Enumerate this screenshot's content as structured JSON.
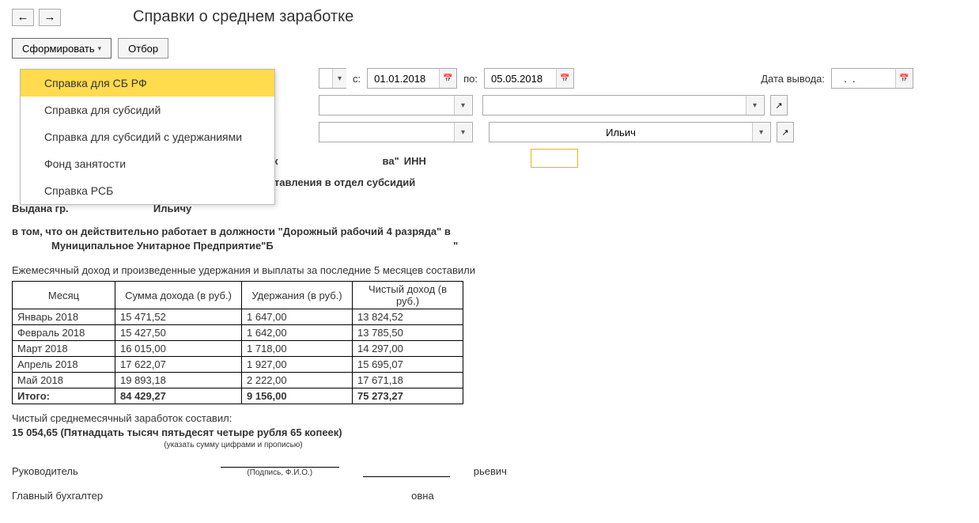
{
  "nav": {
    "back": "←",
    "forward": "→"
  },
  "header": {
    "title": "Справки о среднем заработке"
  },
  "toolbar": {
    "generate_label": "Сформировать",
    "filter_label": "Отбор"
  },
  "menu": {
    "items": [
      "Справка для СБ РФ",
      "Справка для субсидий",
      "Справка для субсидий с удержаниями",
      "Фонд занятости",
      "Справка РСБ"
    ]
  },
  "filters": {
    "from_label": "с:",
    "from_value": "01.01.2018",
    "to_label": "по:",
    "to_value": "05.05.2018",
    "output_date_label": "Дата вывода:",
    "output_date_value": "  .  .    ",
    "person_value": "Ильич"
  },
  "report": {
    "inn_fragment_left": "к",
    "inn_fragment_mid": "ва\"",
    "inn_label": "ИНН",
    "title": "Справка о заработной плате для предоставления в  отдел субсидий",
    "issued_prefix": "Выдана гр.  ",
    "issued_name_suffix": "Ильичу",
    "works_text_1": "в том, что он действительно работает  в должности \"Дорожный рабочий 4 разряда\"   в",
    "works_text_2": "Муниципальное Унитарное Предприятие\"Б",
    "works_text_2_end": "\"",
    "monthly_text": "Ежемесячный доход и произведенные удержания и выплаты за последние 5 месяцев составили",
    "columns": [
      "Месяц",
      "Сумма дохода (в руб.)",
      "Удержания (в руб.)",
      "Чистый доход (в руб.)"
    ],
    "rows": [
      {
        "m": "Январь 2018",
        "a": "15 471,52",
        "b": "1 647,00",
        "c": "13 824,52"
      },
      {
        "m": "Февраль 2018",
        "a": "15 427,50",
        "b": "1 642,00",
        "c": "13 785,50"
      },
      {
        "m": "Март 2018",
        "a": "16 015,00",
        "b": "1 718,00",
        "c": "14 297,00"
      },
      {
        "m": "Апрель 2018",
        "a": "17 622,07",
        "b": "1 927,00",
        "c": "15 695,07"
      },
      {
        "m": "Май 2018",
        "a": "19 893,18",
        "b": "2 222,00",
        "c": "17 671,18"
      }
    ],
    "total_label": "Итого:",
    "total_a": "84 429,27",
    "total_b": "9 156,00",
    "total_c": "75 273,27",
    "avg_label": "Чистый среднемесячный заработок составил:",
    "avg_value": "15 054,65 (Пятнадцать тысяч пятьдесят четыре рубля 65 копеек)",
    "avg_hint": "(указать сумму цифрами и прописью)",
    "manager_label": "Руководитель",
    "manager_end": "рьевич",
    "sign_hint": "(Подпись, Ф.И.О.)",
    "accountant_label": "Главный бухгалтер",
    "accountant_end": "овна"
  }
}
